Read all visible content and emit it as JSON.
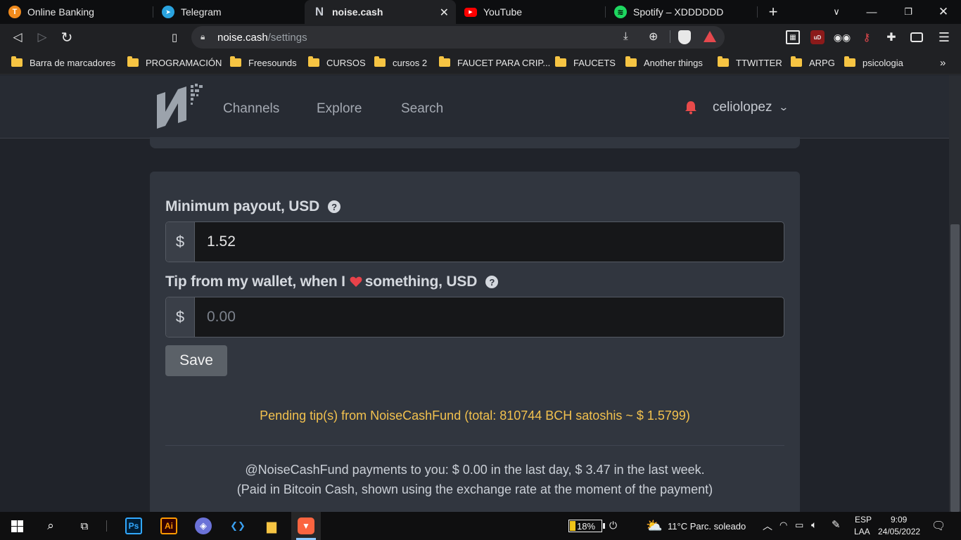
{
  "browser": {
    "tabs": [
      {
        "title": "Online Banking",
        "icon": "bank-icon",
        "icon_glyph": "T",
        "icon_color": "#f08a1c"
      },
      {
        "title": "Telegram",
        "icon": "telegram-icon",
        "icon_glyph": "➤",
        "icon_color": "#2aa3df"
      },
      {
        "title": "noise.cash",
        "icon": "noise-cash-icon",
        "icon_glyph": "N",
        "icon_color": "#9aa0a6"
      },
      {
        "title": "YouTube",
        "icon": "youtube-icon",
        "icon_glyph": "▶",
        "icon_color": "#ff0000"
      },
      {
        "title": "Spotify – XDDDDDD",
        "icon": "spotify-icon",
        "icon_glyph": "≋",
        "icon_color": "#1ed760"
      }
    ],
    "active_tab": 2,
    "new_tab_glyph": "+",
    "url_host": "noise.cash",
    "url_path": "/settings"
  },
  "bookmarks": [
    {
      "label": "Barra de marcadores"
    },
    {
      "label": "PROGRAMACIÓN"
    },
    {
      "label": "Freesounds"
    },
    {
      "label": "CURSOS"
    },
    {
      "label": "cursos 2"
    },
    {
      "label": "FAUCET PARA CRIP..."
    },
    {
      "label": "FAUCETS"
    },
    {
      "label": "Another things"
    },
    {
      "label": "TTWITTER"
    },
    {
      "label": "ARPG"
    },
    {
      "label": "psicologia"
    }
  ],
  "bookmarks_more": "»",
  "site": {
    "nav": [
      {
        "label": "Channels"
      },
      {
        "label": "Explore"
      },
      {
        "label": "Search"
      }
    ],
    "username": "celiolopez",
    "accent_bell_color": "#e84a4a"
  },
  "settings": {
    "min_payout_label": "Minimum payout, USD",
    "currency_symbol": "$",
    "min_payout_value": "1.52",
    "tip_label_before": "Tip from my wallet, when I",
    "tip_label_after": "something, USD",
    "tip_placeholder": "0.00",
    "help_glyph": "?",
    "save_label": "Save",
    "pending_text": "Pending tip(s) from NoiseCashFund (total: 810744 BCH satoshis ~ $ 1.5799)",
    "payments_line1": "@NoiseCashFund payments to you: $ 0.00 in the last day, $ 3.47 in the last week.",
    "payments_line2": "(Paid in Bitcoin Cash, shown using the exchange rate at the moment of the payment)"
  },
  "taskbar": {
    "apps": [
      {
        "name": "photoshop-icon",
        "glyph": "Ps",
        "color": "#31a8ff",
        "bg": "#001e36"
      },
      {
        "name": "illustrator-icon",
        "glyph": "Ai",
        "color": "#ff9a00",
        "bg": "#330000"
      },
      {
        "name": "brave-vpn-icon",
        "glyph": "◈",
        "color": "#ffffff",
        "bg": "#6b72d8"
      },
      {
        "name": "vscode-icon",
        "glyph": "❮❯",
        "color": "#3ba1f1",
        "bg": "transparent"
      },
      {
        "name": "file-explorer-icon",
        "glyph": "▆",
        "color": "#f6c443",
        "bg": "transparent"
      },
      {
        "name": "brave-browser-icon",
        "glyph": "▼",
        "color": "#ffffff",
        "bg": "#fb542b"
      }
    ],
    "battery": "18%",
    "weather": "11°C  Parc. soleado",
    "lang_top": "ESP",
    "lang_bottom": "LAA",
    "time": "9:09",
    "date": "24/05/2022"
  }
}
